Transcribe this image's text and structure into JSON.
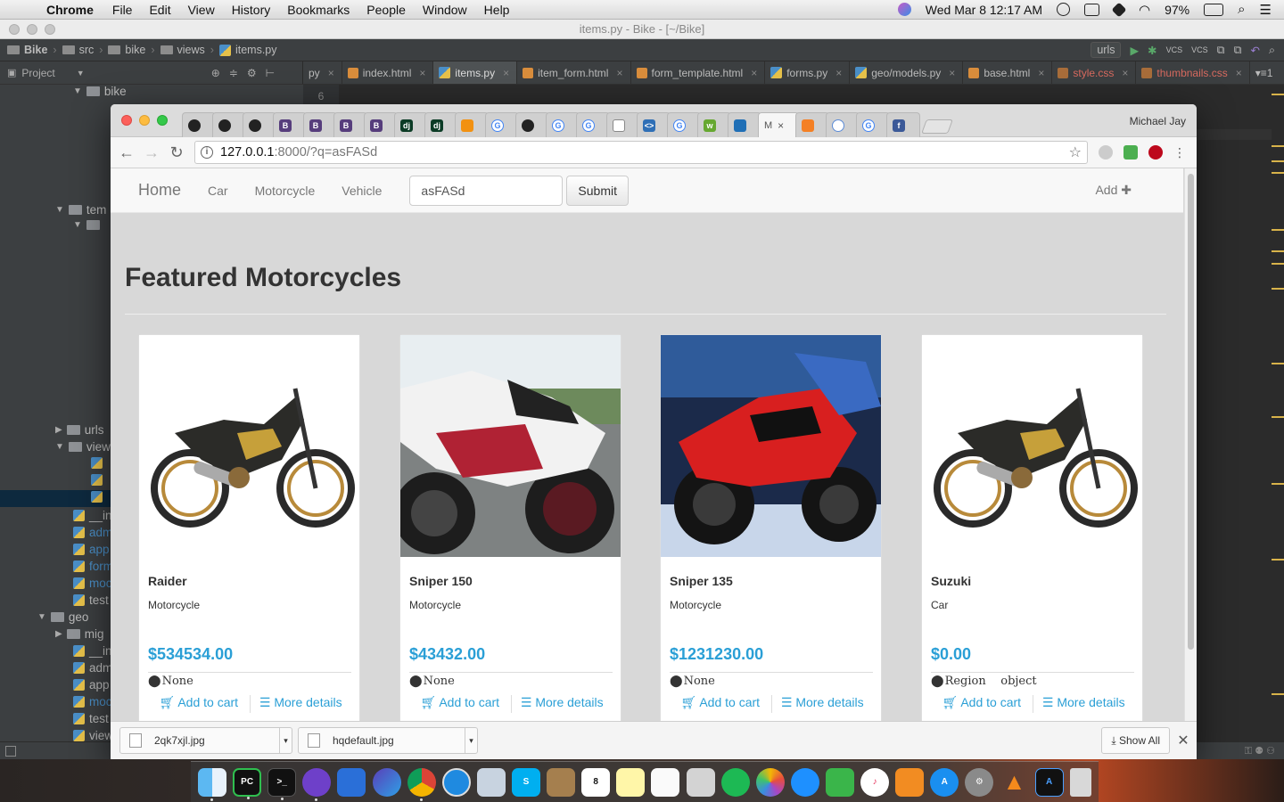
{
  "menubar": {
    "app": "Chrome",
    "items": [
      "File",
      "Edit",
      "View",
      "History",
      "Bookmarks",
      "People",
      "Window",
      "Help"
    ],
    "clock": "Wed Mar 8  12:17 AM",
    "battery": "97%"
  },
  "ide": {
    "window_title": "items.py - Bike - [~/Bike]",
    "breadcrumbs": [
      "Bike",
      "src",
      "bike",
      "views",
      "items.py"
    ],
    "run_config": "urls",
    "project_label": "Project",
    "editor_tabs": [
      {
        "label": "py",
        "type": "py"
      },
      {
        "label": "index.html",
        "type": "html"
      },
      {
        "label": "items.py",
        "type": "py",
        "active": true
      },
      {
        "label": "item_form.html",
        "type": "html"
      },
      {
        "label": "form_template.html",
        "type": "html"
      },
      {
        "label": "forms.py",
        "type": "py"
      },
      {
        "label": "geo/models.py",
        "type": "py"
      },
      {
        "label": "base.html",
        "type": "html"
      },
      {
        "label": "style.css",
        "type": "css",
        "error": true
      },
      {
        "label": "thumbnails.css",
        "type": "css",
        "error": true
      }
    ],
    "line_number": "6",
    "tree": [
      {
        "label": "bike",
        "kind": "folder",
        "open": true
      },
      {
        "label": "tem",
        "kind": "folder",
        "open": true
      },
      {
        "label": "urls",
        "kind": "folder",
        "open": false
      },
      {
        "label": "view",
        "kind": "folder",
        "open": true
      },
      {
        "label": "__in",
        "kind": "py"
      },
      {
        "label": "adm",
        "kind": "py"
      },
      {
        "label": "app",
        "kind": "py"
      },
      {
        "label": "form",
        "kind": "py"
      },
      {
        "label": "moc",
        "kind": "py"
      },
      {
        "label": "test",
        "kind": "py"
      },
      {
        "label": "geo",
        "kind": "folder",
        "open": true
      },
      {
        "label": "mig",
        "kind": "folder",
        "open": false
      },
      {
        "label": "__in",
        "kind": "py"
      },
      {
        "label": "adm",
        "kind": "py"
      },
      {
        "label": "app",
        "kind": "py"
      },
      {
        "label": "moc",
        "kind": "py"
      },
      {
        "label": "test",
        "kind": "py"
      },
      {
        "label": "view",
        "kind": "py"
      }
    ]
  },
  "browser": {
    "profile": "Michael Jay",
    "active_tab_label": "M",
    "url_host": "127.0.0.1",
    "url_path": ":8000/?q=asFASd"
  },
  "site": {
    "brand": "Home",
    "nav": [
      "Car",
      "Motorcycle",
      "Vehicle"
    ],
    "search_value": "asFASd",
    "submit": "Submit",
    "add": "Add"
  },
  "page_title": "Featured Motorcycles",
  "cards": [
    {
      "name": "Raider",
      "category": "Motorcycle",
      "price": "$534534.00",
      "location": "None",
      "add": "Add to cart",
      "details": "More details"
    },
    {
      "name": "Sniper 150",
      "category": "Motorcycle",
      "price": "$43432.00",
      "location": "None",
      "add": "Add to cart",
      "details": "More details"
    },
    {
      "name": "Sniper 135",
      "category": "Motorcycle",
      "price": "$1231230.00",
      "location": "None",
      "add": "Add to cart",
      "details": "More details"
    },
    {
      "name": "Suzuki",
      "category": "Car",
      "price": "$0.00",
      "location": "Region    object",
      "add": "Add to cart",
      "details": "More details"
    }
  ],
  "downloads": {
    "files": [
      "2qk7xjl.jpg",
      "hqdefault.jpg"
    ],
    "show_all": "Show All"
  }
}
